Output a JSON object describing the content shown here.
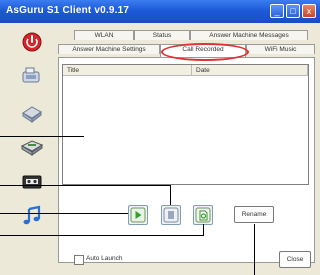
{
  "window": {
    "title": "AsGuru S1 Client v0.9.17",
    "minimize_glyph": "_",
    "maximize_glyph": "□",
    "close_glyph": "x"
  },
  "tabs_row1": [
    "WLAN",
    "Status",
    "Answer Machine Messages"
  ],
  "tabs_row2": [
    "Answer Machine Settings",
    "Call Recorded",
    "WiFi Music"
  ],
  "active_tab": "Call Recorded",
  "table": {
    "columns": [
      "Title",
      "Date"
    ]
  },
  "buttons": {
    "rename": "Rename",
    "close": "Close"
  },
  "checkbox": {
    "label": "Auto Launch",
    "checked": false
  },
  "sidebar_icons": [
    "red-power-icon",
    "phone-device-icon",
    "memory-device-icon",
    "drive-icon",
    "cassette-icon",
    "music-note-icon"
  ],
  "action_icons": [
    "play-icon",
    "stop-icon",
    "delete-file-icon"
  ],
  "colors": {
    "titlebar": "#1d5ad8",
    "accent_red": "#d33",
    "music_blue": "#2a6fd6",
    "play_green": "#2aa52a"
  }
}
